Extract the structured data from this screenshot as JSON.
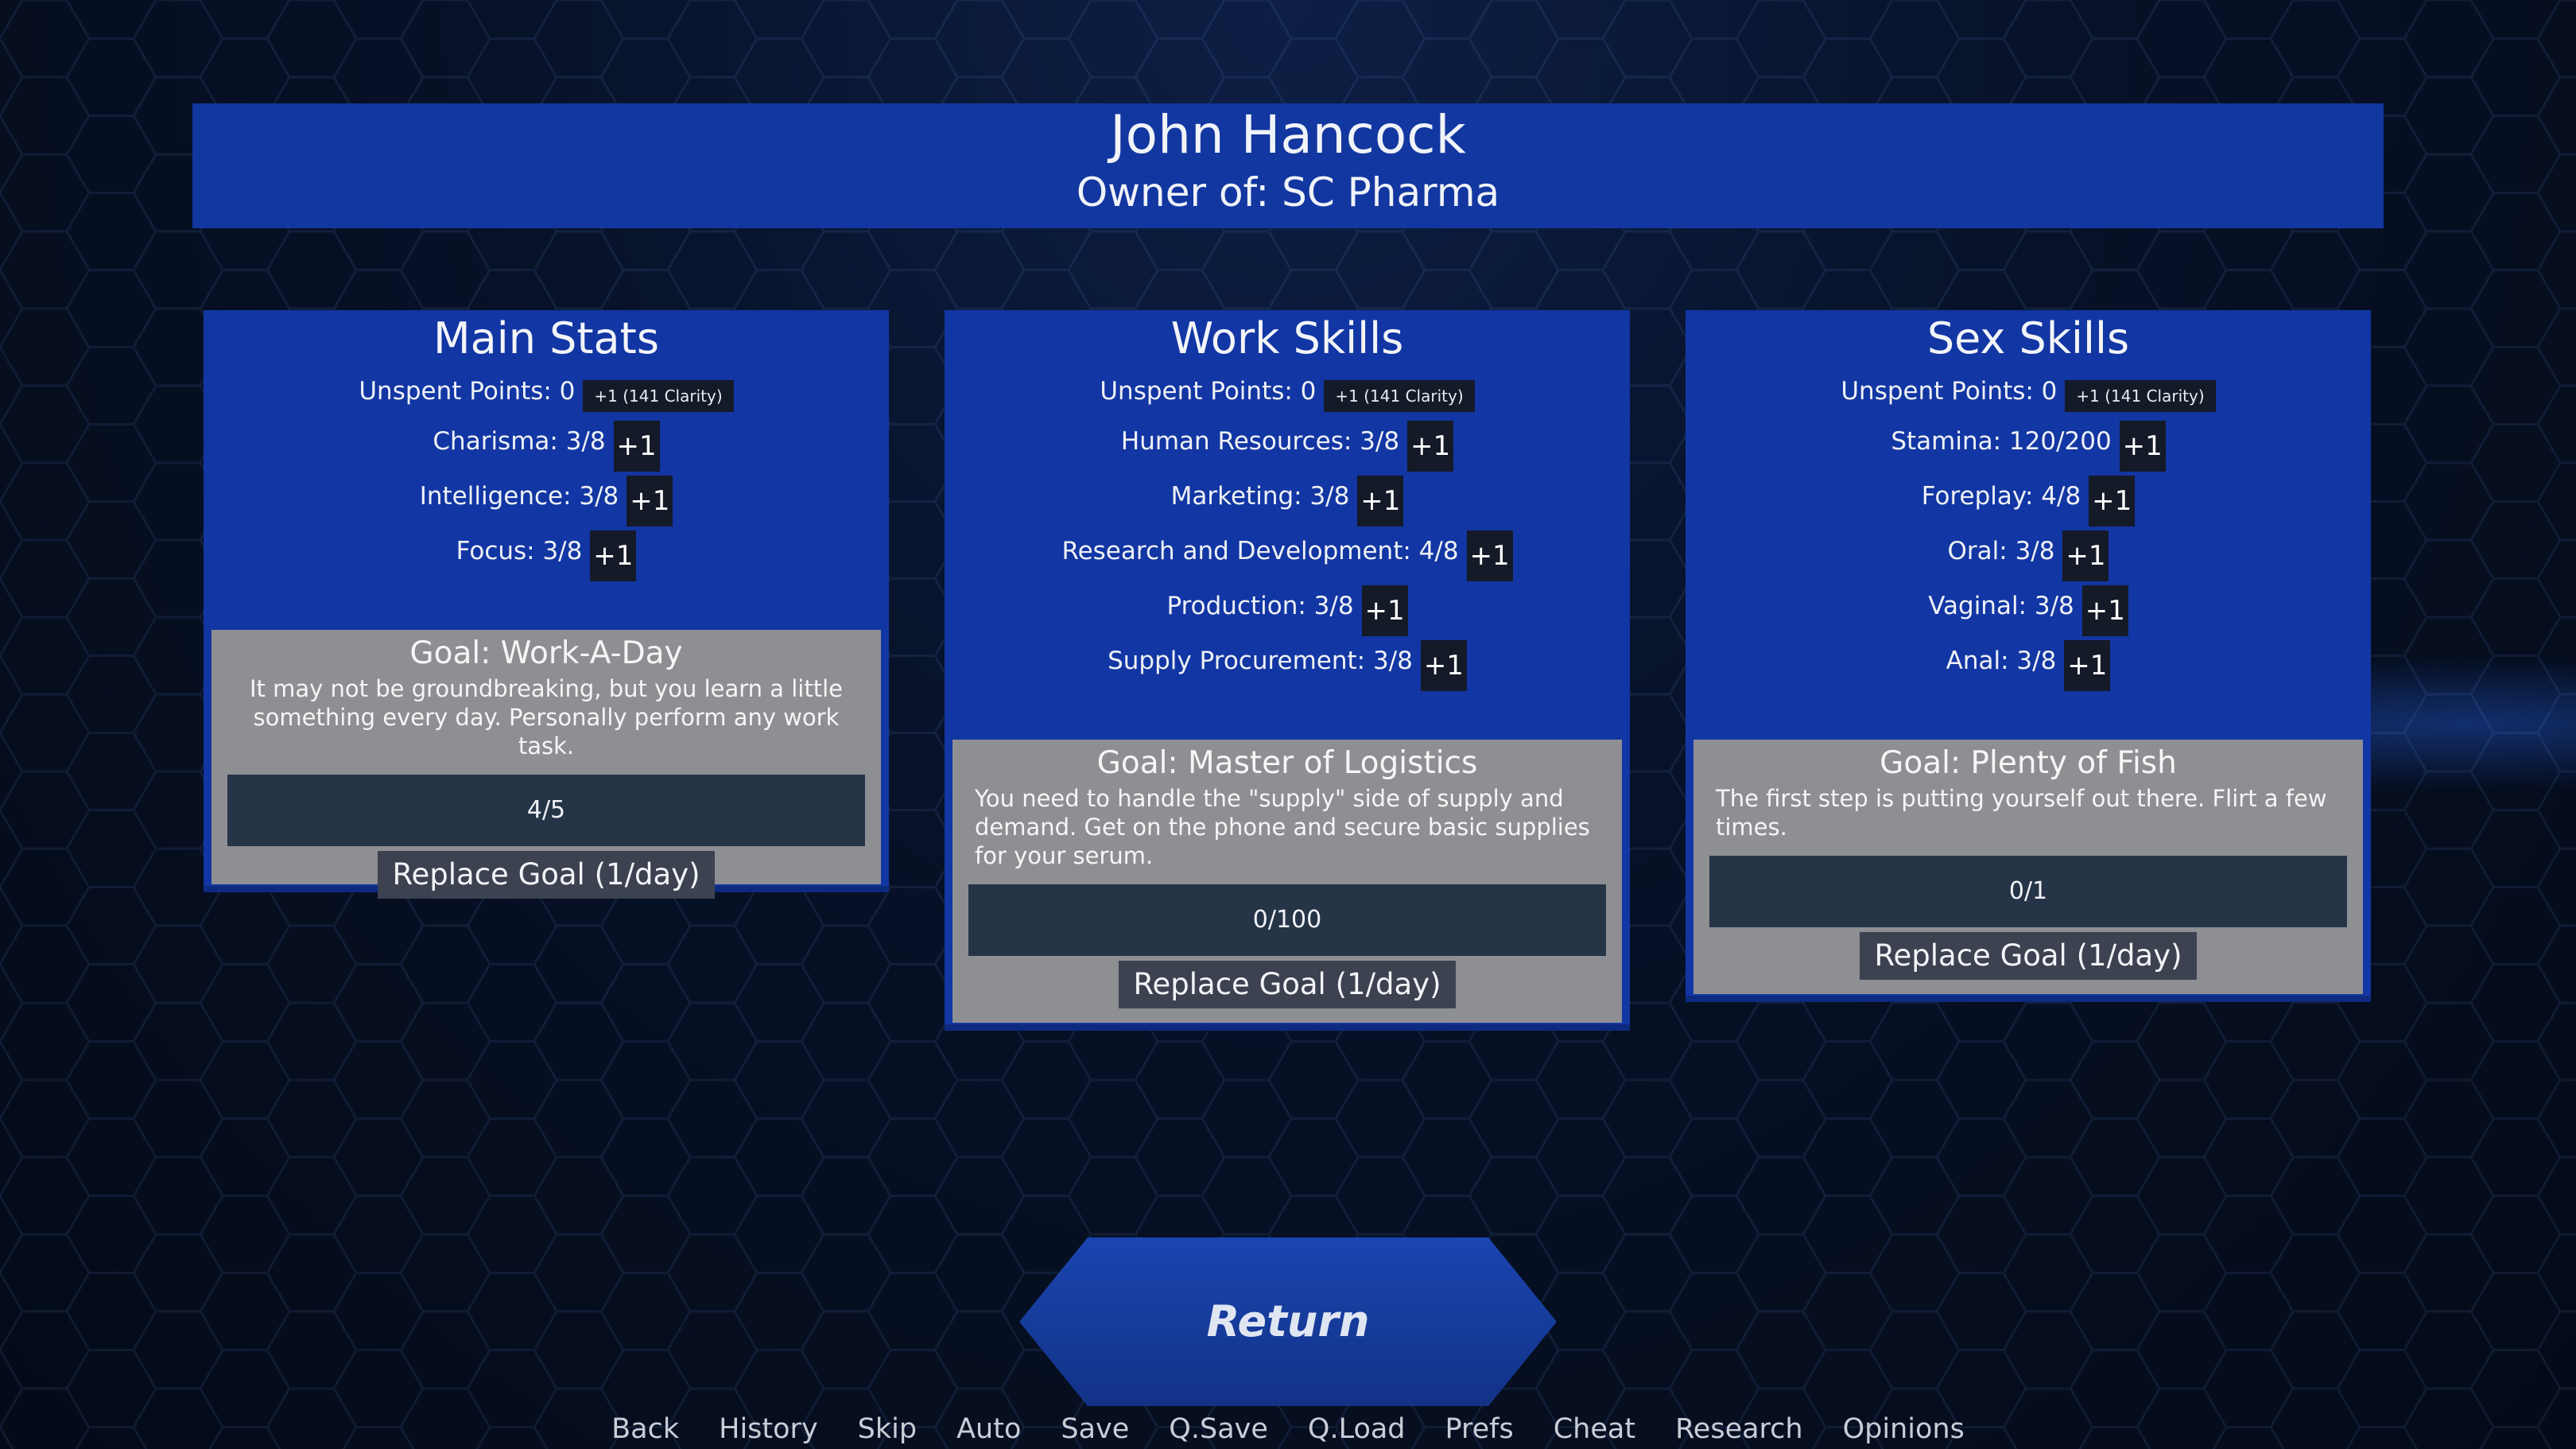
{
  "header": {
    "name": "John Hancock",
    "owner": "Owner of: SC Pharma"
  },
  "panels": {
    "main": {
      "title": "Main Stats",
      "unspent": "Unspent Points: 0",
      "unspent_bonus": "+1 (141 Clarity)",
      "stats": [
        {
          "label": "Charisma: 3/8",
          "plus": "+1"
        },
        {
          "label": "Intelligence: 3/8",
          "plus": "+1"
        },
        {
          "label": "Focus: 3/8",
          "plus": "+1"
        }
      ],
      "goal": {
        "title": "Goal: Work-A-Day",
        "desc": "It may not be groundbreaking, but you learn a little something every day. Personally perform any work task.",
        "progress": "4/5",
        "progress_fraction": 0.8,
        "replace": "Replace Goal (1/day)"
      }
    },
    "work": {
      "title": "Work Skills",
      "unspent": "Unspent Points: 0",
      "unspent_bonus": "+1 (141 Clarity)",
      "stats": [
        {
          "label": "Human Resources: 3/8",
          "plus": "+1"
        },
        {
          "label": "Marketing: 3/8",
          "plus": "+1"
        },
        {
          "label": "Research and Development: 4/8",
          "plus": "+1"
        },
        {
          "label": "Production: 3/8",
          "plus": "+1"
        },
        {
          "label": "Supply Procurement: 3/8",
          "plus": "+1"
        }
      ],
      "goal": {
        "title": "Goal: Master of Logistics",
        "desc": "You need to handle the \"supply\" side of supply and demand. Get on the phone and secure basic supplies for your serum.",
        "progress": "0/100",
        "progress_fraction": 0,
        "replace": "Replace Goal (1/day)"
      }
    },
    "sex": {
      "title": "Sex Skills",
      "unspent": "Unspent Points: 0",
      "unspent_bonus": "+1 (141 Clarity)",
      "stats": [
        {
          "label": "Stamina: 120/200",
          "plus": "+1"
        },
        {
          "label": "Foreplay: 4/8",
          "plus": "+1"
        },
        {
          "label": "Oral: 3/8",
          "plus": "+1"
        },
        {
          "label": "Vaginal: 3/8",
          "plus": "+1"
        },
        {
          "label": "Anal: 3/8",
          "plus": "+1"
        }
      ],
      "goal": {
        "title": "Goal: Plenty of Fish",
        "desc": "The first step is putting yourself out there. Flirt a few times.",
        "progress": "0/1",
        "progress_fraction": 0,
        "replace": "Replace Goal (1/day)"
      }
    }
  },
  "return_label": "Return",
  "quick_menu": [
    "Back",
    "History",
    "Skip",
    "Auto",
    "Save",
    "Q.Save",
    "Q.Load",
    "Prefs",
    "Cheat",
    "Research",
    "Opinions"
  ],
  "colors": {
    "panel": "#1236a3",
    "header": "#1337a0",
    "goal_box": "#8e8f93",
    "progress_bar": "#263448",
    "plus_button": "#141a27"
  }
}
